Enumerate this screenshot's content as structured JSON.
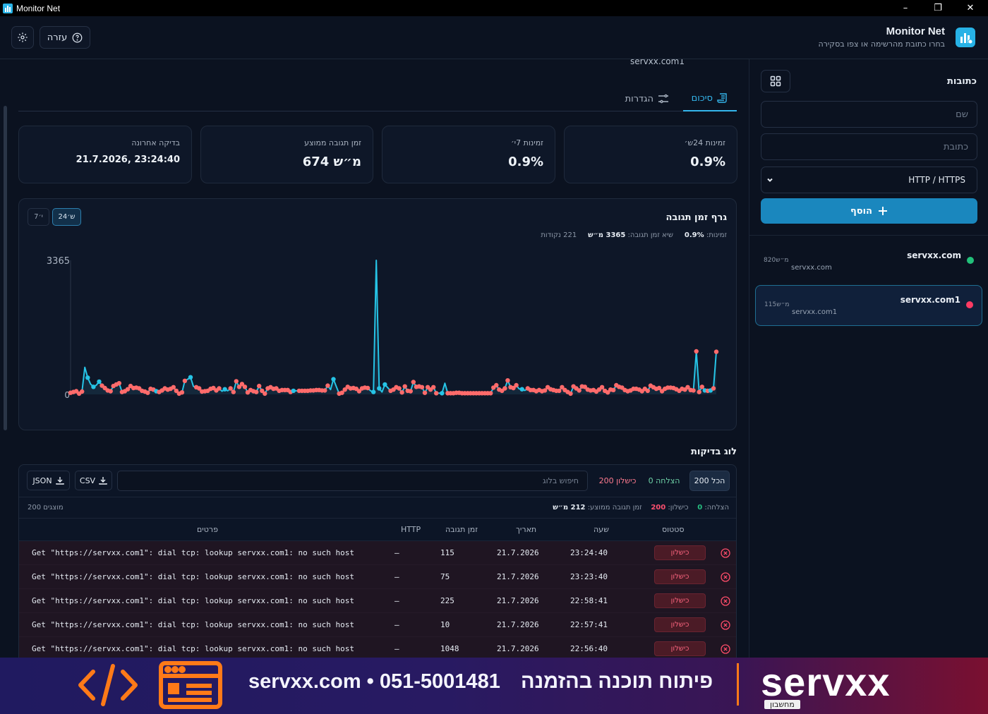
{
  "window": {
    "title": "Monitor Net",
    "minimize_glyph": "–",
    "maximize_glyph": "❐",
    "close_glyph": "✕"
  },
  "header": {
    "app_title": "Monitor Net",
    "app_subtitle": "בחרו כתובת מהרשימה או צפו בסקירה",
    "help_label": "עזרה",
    "settings_icon": "gear-icon",
    "help_icon": "question-icon"
  },
  "sidebar": {
    "heading": "כתובות",
    "name_placeholder": "שם",
    "address_placeholder": "כתובת",
    "protocol_value": "HTTP / HTTPS",
    "add_label": "הוסף",
    "sites": [
      {
        "name": "servxx.com",
        "url": "servxx.com",
        "ms": "820מ״ש",
        "status_color": "#22c07a"
      },
      {
        "name": "servxx.com1",
        "url": "servxx.com1",
        "ms": "115מ״ש",
        "status_color": "#ff3b63"
      }
    ]
  },
  "main": {
    "domain": "servxx.com1",
    "tabs": [
      {
        "label": "סיכום",
        "icon": "scroll-icon"
      },
      {
        "label": "הגדרות",
        "icon": "sliders-icon"
      }
    ],
    "cards": [
      {
        "label": "זמינות 24ש׳",
        "value": "0.9%"
      },
      {
        "label": "זמינות 7י׳",
        "value": "0.9%"
      },
      {
        "label": "זמן תגובה ממוצע",
        "value": "674 מ״ש"
      },
      {
        "label": "בדיקה אחרונה",
        "value": "21.7.2026, 23:24:40"
      }
    ]
  },
  "chart": {
    "title": "גרף זמן תגובה",
    "range_24h": "24ש׳",
    "range_7d": "7י׳",
    "stats_avail_label": "זמינות:",
    "stats_avail_value": "0.9%",
    "stats_peak_label": "שיא זמן תגובה:",
    "stats_peak_value": "3365 מ״ש",
    "stats_points": "221 נקודות"
  },
  "chart_data": {
    "type": "line",
    "title": "גרף זמן תגובה",
    "ylim": [
      0,
      3365
    ],
    "y_tick_labels": [
      "3365",
      "0"
    ],
    "count": 221,
    "success_color": "#26c4e6",
    "failure_color": "#ff6b6b",
    "values": [
      40,
      60,
      80,
      20,
      70,
      680,
      420,
      260,
      190,
      230,
      320,
      220,
      160,
      100,
      80,
      210,
      250,
      280,
      60,
      80,
      130,
      210,
      160,
      170,
      150,
      90,
      70,
      40,
      140,
      120,
      80,
      60,
      100,
      150,
      120,
      140,
      180,
      90,
      20,
      50,
      340,
      380,
      430,
      200,
      180,
      150,
      70,
      80,
      90,
      140,
      160,
      100,
      150,
      80,
      130,
      90,
      150,
      60,
      330,
      190,
      260,
      190,
      50,
      110,
      80,
      60,
      210,
      90,
      20,
      150,
      180,
      140,
      150,
      90,
      110,
      110,
      110,
      60,
      90,
      90,
      90,
      90,
      90,
      90,
      100,
      100,
      110,
      110,
      100,
      100,
      220,
      120,
      380,
      200,
      20,
      40,
      120,
      190,
      150,
      160,
      140,
      80,
      150,
      170,
      160,
      90,
      60,
      3365,
      150,
      60,
      250,
      170,
      90,
      120,
      180,
      150,
      50,
      200,
      90,
      80,
      310,
      190,
      200,
      180,
      40,
      180,
      120,
      180,
      30,
      30,
      30,
      280,
      30,
      30,
      30,
      40,
      40,
      30,
      30,
      30,
      30,
      30,
      30,
      30,
      30,
      30,
      30,
      30,
      170,
      230,
      120,
      90,
      150,
      350,
      180,
      160,
      230,
      140,
      130,
      100,
      150,
      110,
      110,
      80,
      110,
      80,
      100,
      180,
      130,
      110,
      90,
      90,
      180,
      110,
      60,
      20,
      200,
      150,
      100,
      200,
      190,
      120,
      100,
      110,
      70,
      120,
      180,
      90,
      50,
      120,
      110,
      230,
      190,
      170,
      110,
      80,
      100,
      140,
      140,
      120,
      80,
      140,
      90,
      220,
      180,
      140,
      160,
      80,
      140,
      170,
      170,
      160,
      130,
      90,
      140,
      120,
      180,
      110,
      100,
      1080,
      60,
      190,
      100,
      90,
      100,
      150,
      1070
    ],
    "statuses": [
      0,
      0,
      0,
      0,
      0,
      1,
      1,
      1,
      1,
      1,
      1,
      0,
      0,
      0,
      0,
      0,
      0,
      0,
      0,
      0,
      0,
      0,
      0,
      0,
      0,
      0,
      0,
      0,
      0,
      0,
      1,
      0,
      0,
      0,
      0,
      0,
      0,
      0,
      0,
      0,
      0,
      1,
      1,
      1,
      0,
      0,
      0,
      0,
      0,
      0,
      0,
      0,
      0,
      1,
      1,
      1,
      0,
      0,
      0,
      0,
      0,
      0,
      0,
      0,
      0,
      0,
      0,
      0,
      0,
      0,
      0,
      0,
      0,
      0,
      0,
      0,
      0,
      0,
      1,
      1,
      0,
      0,
      0,
      0,
      0,
      0,
      0,
      0,
      0,
      0,
      0,
      1,
      1,
      1,
      0,
      0,
      0,
      0,
      0,
      0,
      0,
      0,
      0,
      0,
      0,
      1,
      1,
      1,
      1,
      1,
      1,
      1,
      0,
      0,
      0,
      0,
      0,
      0,
      0,
      0,
      0,
      0,
      0,
      0,
      0,
      0,
      0,
      0,
      0,
      1,
      1,
      1,
      0,
      0,
      0,
      0,
      0,
      0,
      0,
      0,
      0,
      0,
      0,
      0,
      0,
      0,
      0,
      0,
      0,
      0,
      0,
      0,
      0,
      0,
      0,
      0,
      0,
      1,
      1,
      1,
      0,
      0,
      0,
      0,
      0,
      0,
      0,
      0,
      0,
      0,
      0,
      0,
      0,
      0,
      0,
      0,
      0,
      0,
      0,
      0,
      0,
      0,
      0,
      0,
      0,
      0,
      0,
      0,
      0,
      0,
      0,
      0,
      0,
      0,
      0,
      0,
      0,
      0,
      0,
      0,
      0,
      0,
      0,
      0,
      0,
      0,
      0,
      0,
      0,
      0,
      0,
      0,
      0,
      0,
      0,
      0,
      0,
      0,
      0,
      0,
      0,
      0,
      1,
      0,
      1,
      0,
      0,
      0,
      0,
      0,
      0
    ]
  },
  "log": {
    "title": "לוג בדיקות",
    "filter_all": "הכל 200",
    "filter_success": "הצלחה 0",
    "filter_failure": "כישלון 200",
    "search_placeholder": "חיפוש בלוג",
    "csv_label": "CSV",
    "json_label": "JSON",
    "summary_success_label": "הצלחה:",
    "summary_success_value": "0",
    "summary_failure_label": "כישלון:",
    "summary_failure_value": "200",
    "summary_avg_label": "זמן תגובה ממוצע:",
    "summary_avg_value": "212 מ״ש",
    "shown_count": "200 מוצגים",
    "columns": {
      "status": "סטטוס",
      "time": "שעה",
      "date": "תאריך",
      "response": "זמן תגובה",
      "http": "HTTP",
      "details": "פרטים"
    },
    "rows": [
      {
        "status": "כישלון",
        "time": "23:24:40",
        "date": "21.7.2026",
        "response": "115",
        "http": "—",
        "details": "Get \"https://servxx.com1\": dial tcp: lookup servxx.com1: no such host"
      },
      {
        "status": "כישלון",
        "time": "23:23:40",
        "date": "21.7.2026",
        "response": "75",
        "http": "—",
        "details": "Get \"https://servxx.com1\": dial tcp: lookup servxx.com1: no such host"
      },
      {
        "status": "כישלון",
        "time": "22:58:41",
        "date": "21.7.2026",
        "response": "225",
        "http": "—",
        "details": "Get \"https://servxx.com1\": dial tcp: lookup servxx.com1: no such host"
      },
      {
        "status": "כישלון",
        "time": "22:57:41",
        "date": "21.7.2026",
        "response": "10",
        "http": "—",
        "details": "Get \"https://servxx.com1\": dial tcp: lookup servxx.com1: no such host"
      },
      {
        "status": "כישלון",
        "time": "22:56:40",
        "date": "21.7.2026",
        "response": "1048",
        "http": "—",
        "details": "Get \"https://servxx.com1\": dial tcp: lookup servxx.com1: no such host"
      }
    ]
  },
  "banner": {
    "contact": "servxx.com • 051-5001481",
    "slogan": "פיתוח תוכנה בהזמנה",
    "logo_text": "servxx",
    "logo_tag": "מחשבון"
  }
}
